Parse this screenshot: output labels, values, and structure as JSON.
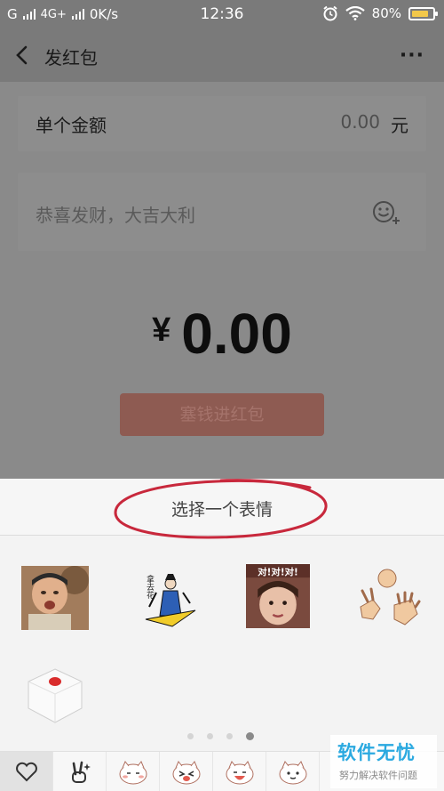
{
  "status_bar": {
    "carrier": "G",
    "network": "4G+",
    "speed": "0K/s",
    "time": "12:36",
    "battery": "80%",
    "battery_level": 0.8,
    "icons": [
      "signal-icon",
      "alarm-icon",
      "wifi-icon",
      "battery-icon"
    ]
  },
  "header": {
    "title": "发红包",
    "back_icon": "back-arrow-icon",
    "more": "···"
  },
  "form": {
    "amount_label": "单个金额",
    "amount_value": "0.00",
    "amount_unit": "元",
    "message_placeholder": "恭喜发财，大吉大利",
    "emoji_icon": "emoji-add-icon"
  },
  "total": {
    "currency": "¥",
    "amount": "0.00"
  },
  "send_button": "塞钱进红包",
  "sticker_panel": {
    "title": "选择一个表情",
    "stickers": [
      {
        "name": "sticker-crying-boy",
        "text": ""
      },
      {
        "name": "sticker-drawing-figure",
        "text": "拿去花"
      },
      {
        "name": "sticker-girl-duiduidui",
        "text": "对!对!对!"
      },
      {
        "name": "sticker-rock-paper-scissors",
        "text": ""
      },
      {
        "name": "sticker-dice",
        "text": ""
      }
    ],
    "page_count": 4,
    "current_page": 4,
    "tabs": [
      "heart-icon",
      "victory-hand-icon",
      "cat-face-icon",
      "cat-face-2-icon",
      "cat-face-3-icon",
      "cat-face-4-icon"
    ]
  },
  "watermark": {
    "main": "软件无忧",
    "sub": "努力解决软件问题"
  },
  "colors": {
    "annotation": "#c8283c",
    "watermark": "#2aa9e0",
    "send_button": "#8e5b52"
  }
}
